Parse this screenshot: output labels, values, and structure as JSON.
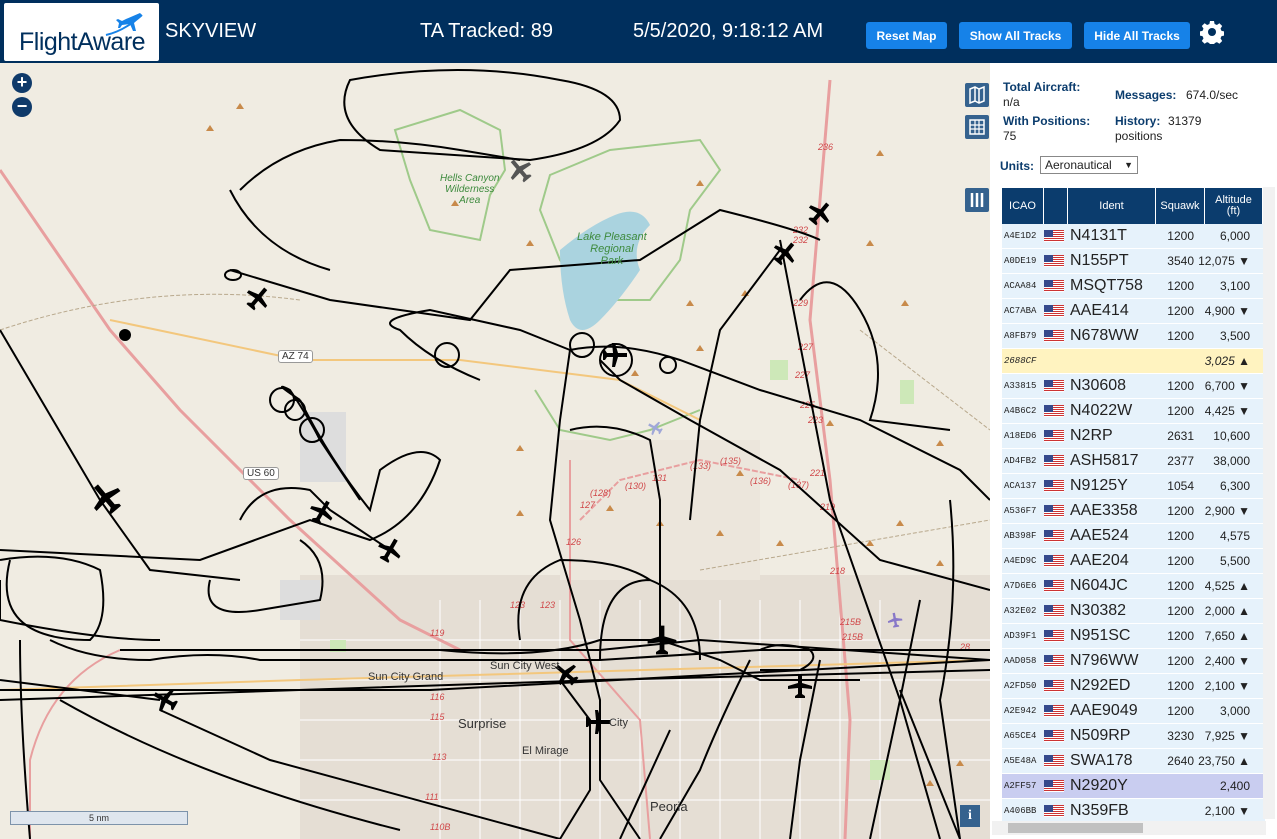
{
  "header": {
    "logo_text": "FlightAware",
    "app_name": "SKYVIEW",
    "tracked": "TA Tracked: 89",
    "datetime": "5/5/2020, 9:18:12 AM",
    "buttons": {
      "reset": "Reset Map",
      "show_all": "Show All Tracks",
      "hide_all": "Hide All Tracks"
    },
    "settings_icon": "gear-icon"
  },
  "map": {
    "zoom_in": "+",
    "zoom_out": "−",
    "scale_label": "5 nm",
    "info_label": "i",
    "labels": {
      "hells_canyon": "Hells Canyon\nWilderness\nArea",
      "lake_pleasant": "Lake Pleasant\nRegional\nPark",
      "az74": "AZ 74",
      "us60": "US 60",
      "sun_city_grand": "Sun City Grand",
      "sun_city_west": "Sun City West",
      "surprise": "Surprise",
      "el_mirage": "El Mirage",
      "peoria": "Peoria",
      "city": "City"
    },
    "colors": {
      "land": "#f0ece2",
      "water": "#aad3df",
      "park_border": "#9fca8a",
      "highway": "#e89f9f",
      "track": "#000000"
    }
  },
  "panel": {
    "total_aircraft_label": "Total Aircraft:",
    "total_aircraft_value": "n/a",
    "with_positions_label": "With Positions:",
    "with_positions_value": "75",
    "messages_label": "Messages:",
    "messages_value": "674.0/sec",
    "history_label": "History:",
    "history_value": "31379",
    "history_unit": "positions",
    "units_label": "Units:",
    "units_value": "Aeronautical",
    "columns": {
      "icao": "ICAO",
      "ident": "Ident",
      "squawk": "Squawk",
      "altitude": "Altitude\n(ft)"
    },
    "rows": [
      {
        "icao": "A4E1D2",
        "ident": "N4131T",
        "squawk": "1200",
        "alt": "6,000",
        "flag": true,
        "style": "light"
      },
      {
        "icao": "A0DE19",
        "ident": "N155PT",
        "squawk": "3540",
        "alt": "12,075 ▼",
        "flag": true,
        "style": "light"
      },
      {
        "icao": "ACAA84",
        "ident": "MSQT758",
        "squawk": "1200",
        "alt": "3,100",
        "flag": true,
        "style": "light"
      },
      {
        "icao": "AC7ABA",
        "ident": "AAE414",
        "squawk": "1200",
        "alt": "4,900 ▼",
        "flag": true,
        "style": "light"
      },
      {
        "icao": "A8FB79",
        "ident": "N678WW",
        "squawk": "1200",
        "alt": "3,500",
        "flag": true,
        "style": "light"
      },
      {
        "icao": "2688CF",
        "ident": "",
        "squawk": "",
        "alt": "3,025 ▲",
        "flag": false,
        "style": "yellow"
      },
      {
        "icao": "A33815",
        "ident": "N30608",
        "squawk": "1200",
        "alt": "6,700 ▼",
        "flag": true,
        "style": "light"
      },
      {
        "icao": "A4B6C2",
        "ident": "N4022W",
        "squawk": "1200",
        "alt": "4,425 ▼",
        "flag": true,
        "style": "light"
      },
      {
        "icao": "A18ED6",
        "ident": "N2RP",
        "squawk": "2631",
        "alt": "10,600",
        "flag": true,
        "style": "light"
      },
      {
        "icao": "AD4FB2",
        "ident": "ASH5817",
        "squawk": "2377",
        "alt": "38,000",
        "flag": true,
        "style": "light"
      },
      {
        "icao": "ACA137",
        "ident": "N9125Y",
        "squawk": "1054",
        "alt": "6,300",
        "flag": true,
        "style": "light"
      },
      {
        "icao": "A536F7",
        "ident": "AAE3358",
        "squawk": "1200",
        "alt": "2,900 ▼",
        "flag": true,
        "style": "light"
      },
      {
        "icao": "AB398F",
        "ident": "AAE524",
        "squawk": "1200",
        "alt": "4,575",
        "flag": true,
        "style": "light"
      },
      {
        "icao": "A4ED9C",
        "ident": "AAE204",
        "squawk": "1200",
        "alt": "5,500",
        "flag": true,
        "style": "light"
      },
      {
        "icao": "A7D6E6",
        "ident": "N604JC",
        "squawk": "1200",
        "alt": "4,525 ▲",
        "flag": true,
        "style": "light"
      },
      {
        "icao": "A32E02",
        "ident": "N30382",
        "squawk": "1200",
        "alt": "2,000 ▲",
        "flag": true,
        "style": "light"
      },
      {
        "icao": "AD39F1",
        "ident": "N951SC",
        "squawk": "1200",
        "alt": "7,650 ▲",
        "flag": true,
        "style": "light"
      },
      {
        "icao": "AAD058",
        "ident": "N796WW",
        "squawk": "1200",
        "alt": "2,400 ▼",
        "flag": true,
        "style": "light"
      },
      {
        "icao": "A2FD50",
        "ident": "N292ED",
        "squawk": "1200",
        "alt": "2,100 ▼",
        "flag": true,
        "style": "light"
      },
      {
        "icao": "A2E942",
        "ident": "AAE9049",
        "squawk": "1200",
        "alt": "3,000",
        "flag": true,
        "style": "light"
      },
      {
        "icao": "A65CE4",
        "ident": "N509RP",
        "squawk": "3230",
        "alt": "7,925 ▼",
        "flag": true,
        "style": "light"
      },
      {
        "icao": "A5E48A",
        "ident": "SWA178",
        "squawk": "2640",
        "alt": "23,750 ▲",
        "flag": true,
        "style": "light"
      },
      {
        "icao": "A2FF57",
        "ident": "N2920Y",
        "squawk": "",
        "alt": "2,400",
        "flag": true,
        "style": "selected"
      },
      {
        "icao": "A406BB",
        "ident": "N359FB",
        "squawk": "",
        "alt": "2,100 ▼",
        "flag": true,
        "style": "light"
      }
    ],
    "row_colors": {
      "light": "#e6f2fb",
      "yellow": "#fff3c0",
      "selected": "#c9cdf0"
    }
  }
}
